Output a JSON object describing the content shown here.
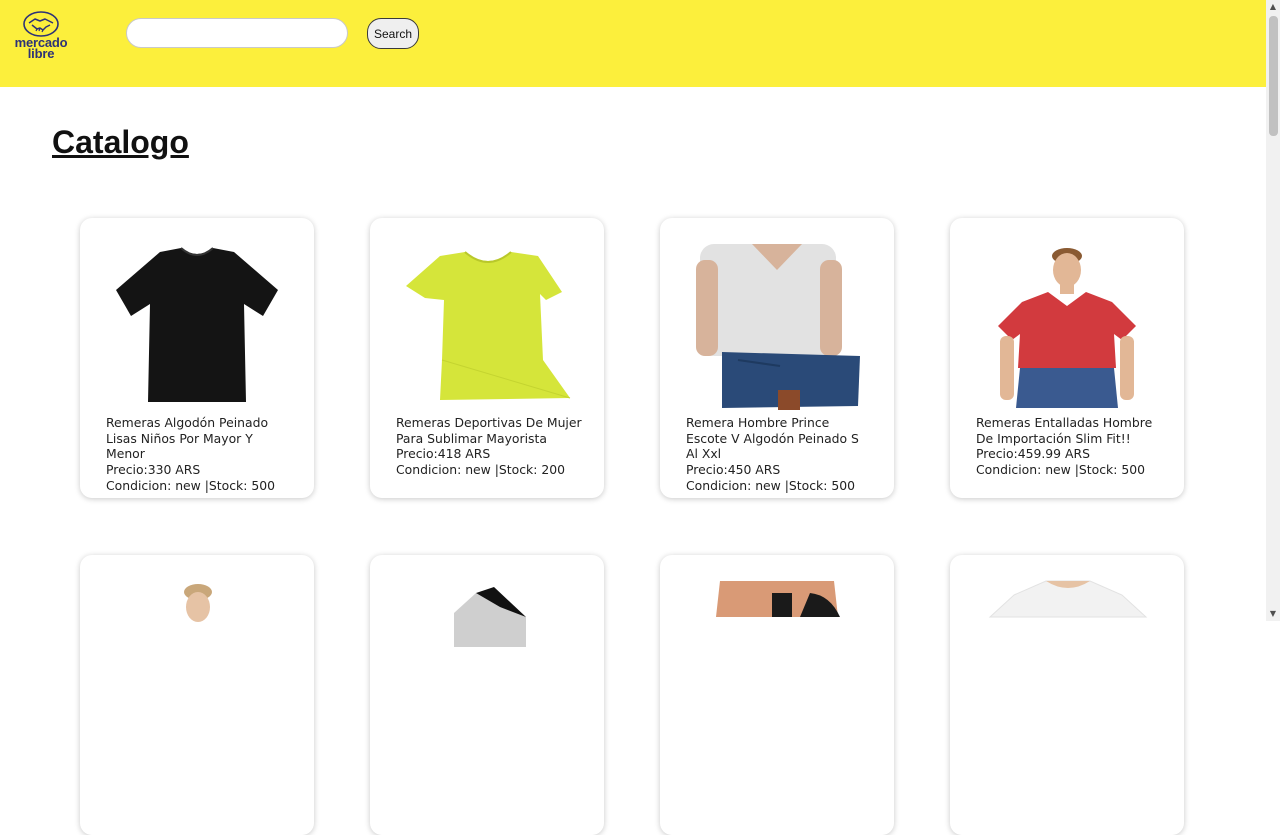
{
  "header": {
    "logo": {
      "line1": "mercado",
      "line2": "libre"
    },
    "search": {
      "value": "",
      "placeholder": ""
    },
    "search_button_label": "Search",
    "brand_color": "#fcef3c"
  },
  "page": {
    "title": "Catalogo"
  },
  "products": [
    {
      "name": "Remeras Algodón Peinado Lisas Niños Por Mayor Y Menor",
      "price": "Precio:330 ARS",
      "condition": "Condicion: new",
      "stock": " |Stock: 500",
      "image": "black-tshirt"
    },
    {
      "name": "Remeras Deportivas De Mujer Para Sublimar Mayorista",
      "price": "Precio:418 ARS",
      "condition": "Condicion: new",
      "stock": " |Stock: 200",
      "image": "lime-womens-tshirt"
    },
    {
      "name": "Remera Hombre Prince Escote V Algodón Peinado S Al Xxl",
      "price": "Precio:450 ARS",
      "condition": "Condicion: new",
      "stock": " |Stock: 500",
      "image": "man-grey-vneck"
    },
    {
      "name": "Remeras Entalladas Hombre De Importación Slim Fit!!",
      "price": "Precio:459.99 ARS",
      "condition": "Condicion: new",
      "stock": " |Stock: 500",
      "image": "man-red-tshirt"
    },
    {
      "name": "",
      "price": "",
      "condition": "",
      "stock": "",
      "image": "man-partial"
    },
    {
      "name": "",
      "price": "",
      "condition": "",
      "stock": "",
      "image": "dark-shirt-partial"
    },
    {
      "name": "",
      "price": "",
      "condition": "",
      "stock": "",
      "image": "woman-black-top-partial"
    },
    {
      "name": "",
      "price": "",
      "condition": "",
      "stock": "",
      "image": "man-white-tshirt-partial"
    }
  ]
}
